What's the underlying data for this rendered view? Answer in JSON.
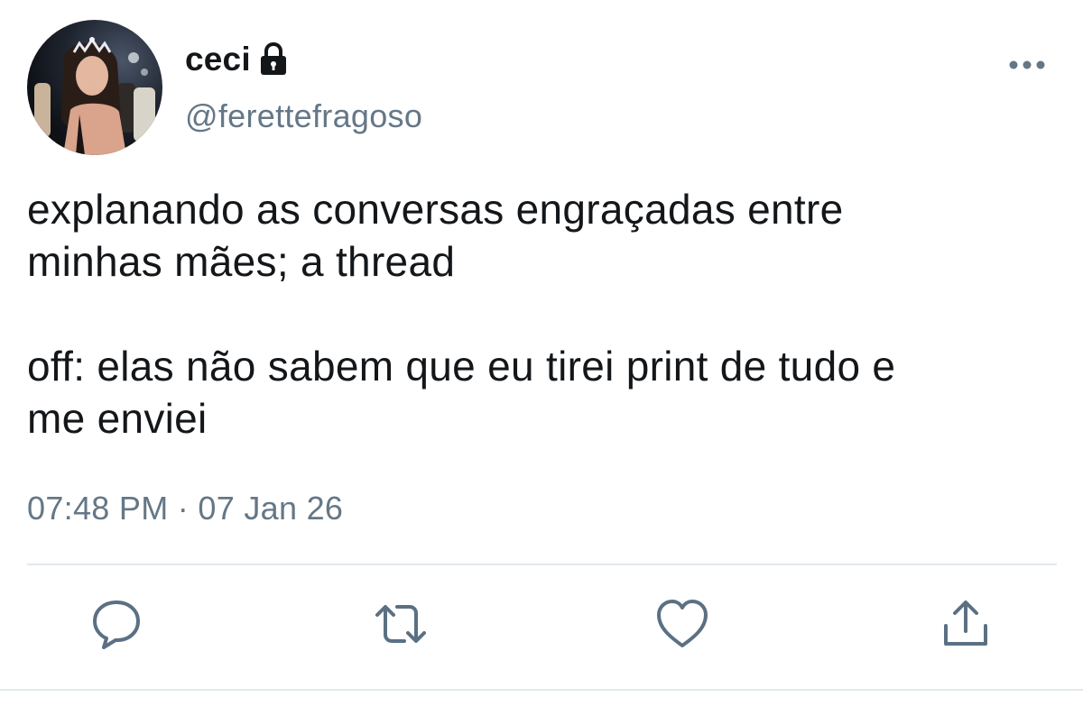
{
  "tweet": {
    "display_name": "ceci",
    "handle": "@ferettefragoso",
    "text_lines": [
      "explanando as conversas engraçadas entre",
      "minhas mães; a thread",
      "off: elas não sabem que eu tirei print de tudo e",
      "me enviei"
    ],
    "timestamp": "07:48 PM · 07 Jan 26",
    "protected_icon": "lock-icon",
    "more_icon": "more-horizontal-icon"
  },
  "actions": [
    {
      "name": "reply",
      "icon": "reply-icon"
    },
    {
      "name": "retweet",
      "icon": "retweet-icon"
    },
    {
      "name": "like",
      "icon": "heart-icon"
    },
    {
      "name": "share",
      "icon": "share-icon"
    }
  ],
  "colors": {
    "text_primary": "#14171a",
    "text_secondary": "#657786",
    "divider": "#e1e8ed",
    "icon": "#5b7083"
  }
}
